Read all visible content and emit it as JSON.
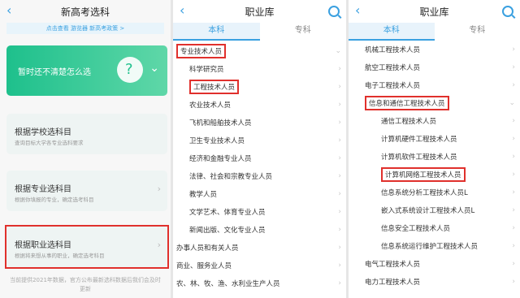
{
  "panel1": {
    "title": "新高考选科",
    "notice": "点击查看 游览器 新高考政策 >",
    "hero_text": "暂时还不清楚怎么选",
    "cards": [
      {
        "title": "根据学校选科目",
        "desc": "查询目标大学各专业选科要求"
      },
      {
        "title": "根据专业选科目",
        "desc": "根据你填报的专业，确定选考科目"
      },
      {
        "title": "根据职业选科目",
        "desc": "根据将来想从事的职业，确定选考科目"
      }
    ],
    "footer": "当前提供2021年数据，官方公布最新选科数据后我们会及时更新"
  },
  "panel2": {
    "title": "职业库",
    "tabs": [
      "本科",
      "专科"
    ],
    "items": [
      {
        "label": "专业技术人员",
        "level": 1
      },
      {
        "label": "科学研究员",
        "level": 2
      },
      {
        "label": "工程技术人员",
        "level": 2
      },
      {
        "label": "农业技术人员",
        "level": 2
      },
      {
        "label": "飞机和船舶技术人员",
        "level": 2
      },
      {
        "label": "卫生专业技术人员",
        "level": 2
      },
      {
        "label": "经济和金融专业人员",
        "level": 2
      },
      {
        "label": "法律、社会和宗教专业人员",
        "level": 2
      },
      {
        "label": "教学人员",
        "level": 2
      },
      {
        "label": "文学艺术、体育专业人员",
        "level": 2
      },
      {
        "label": "新闻出版、文化专业人员",
        "level": 2
      },
      {
        "label": "办事人员和有关人员",
        "level": 1
      },
      {
        "label": "商业、服务业人员",
        "level": 1
      },
      {
        "label": "农、林、牧、渔、水利业生产人员",
        "level": 1
      }
    ]
  },
  "panel3": {
    "title": "职业库",
    "tabs": [
      "本科",
      "专科"
    ],
    "items": [
      {
        "label": "机械工程技术人员",
        "level": 2
      },
      {
        "label": "航空工程技术人员",
        "level": 2
      },
      {
        "label": "电子工程技术人员",
        "level": 2
      },
      {
        "label": "信息和通信工程技术人员",
        "level": 2
      },
      {
        "label": "通信工程技术人员",
        "level": 3
      },
      {
        "label": "计算机硬件工程技术人员",
        "level": 3
      },
      {
        "label": "计算机软件工程技术人员",
        "level": 3
      },
      {
        "label": "计算机网络工程技术人员",
        "level": 3
      },
      {
        "label": "信息系统分析工程技术人员L",
        "level": 3
      },
      {
        "label": "嵌入式系统设计工程技术人员L",
        "level": 3
      },
      {
        "label": "信息安全工程技术人员",
        "level": 3
      },
      {
        "label": "信息系统运行维护工程技术人员",
        "level": 3
      },
      {
        "label": "电气工程技术人员",
        "level": 2
      },
      {
        "label": "电力工程技术人员",
        "level": 2
      }
    ]
  }
}
